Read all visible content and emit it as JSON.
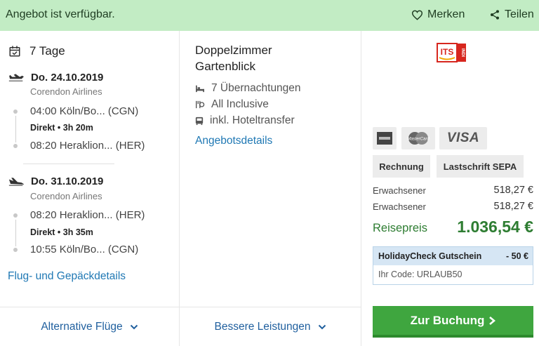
{
  "topbar": {
    "availability": "Angebot ist verfügbar.",
    "save_label": "Merken",
    "share_label": "Teilen"
  },
  "trip": {
    "duration": "7 Tage"
  },
  "outbound": {
    "date": "Do. 24.10.2019",
    "airline": "Corendon Airlines",
    "dep": "04:00 Köln/Bo... (CGN)",
    "direct": "Direkt • 3h 20m",
    "arr": "08:20 Heraklion... (HER)"
  },
  "return": {
    "date": "Do. 31.10.2019",
    "airline": "Corendon Airlines",
    "dep": "08:20 Heraklion... (HER)",
    "direct": "Direkt • 3h 35m",
    "arr": "10:55 Köln/Bo... (CGN)"
  },
  "links": {
    "flight_details": "Flug- und Gepäckdetails",
    "offer_details": "Angebotsdetails"
  },
  "room": {
    "line1": "Doppelzimmer",
    "line2": "Gartenblick"
  },
  "features": [
    "7 Übernachtungen",
    "All Inclusive",
    "inkl. Hoteltransfer"
  ],
  "operator": {
    "logo_text": "ITS",
    "logo_sub": "INDI",
    "brand_color": "#d7261e"
  },
  "payment": {
    "visa": "VISA",
    "invoice": "Rechnung",
    "sepa": "Lastschrift SEPA",
    "mc_text": "MasterCard"
  },
  "prices": {
    "rows": [
      {
        "label": "Erwachsener",
        "value": "518,27 €"
      },
      {
        "label": "Erwachsener",
        "value": "518,27 €"
      }
    ],
    "total_label": "Reisepreis",
    "total_value": "1.036,54 €"
  },
  "voucher": {
    "title": "HolidayCheck Gutschein",
    "discount": "- 50 €",
    "code": "Ihr Code: URLAUB50"
  },
  "cta": {
    "book_label": "Zur Buchung",
    "book_color": "#3fa63f"
  },
  "bottom": {
    "alt_flights": "Alternative Flüge",
    "better_services": "Bessere Leistungen"
  }
}
